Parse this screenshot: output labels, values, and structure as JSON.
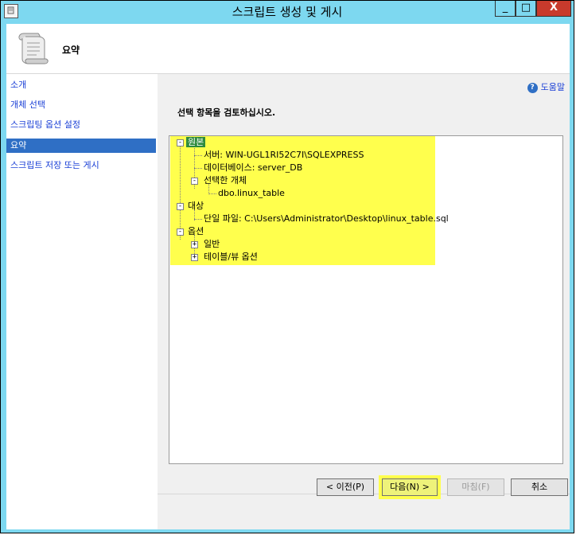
{
  "window": {
    "title": "스크립트 생성 및 게시",
    "controls": {
      "minimize": "_",
      "maximize": "□",
      "close": "X"
    }
  },
  "header": {
    "title": "요약",
    "icon": "scroll-icon"
  },
  "sidebar": {
    "items": [
      {
        "label": "소개",
        "active": false
      },
      {
        "label": "개체 선택",
        "active": false
      },
      {
        "label": "스크립팅 옵션 설정",
        "active": false
      },
      {
        "label": "요약",
        "active": true
      },
      {
        "label": "스크립트 저장 또는 게시",
        "active": false
      }
    ]
  },
  "main": {
    "help_label": "도움말",
    "instruction": "선택 항목을 검토하십시오.",
    "tree": {
      "source": {
        "label": "원본",
        "server": "서버: WIN-UGL1RI52C7I\\SQLEXPRESS",
        "database": "데이터베이스: server_DB",
        "selected_objects": "선택한 개체",
        "object": "dbo.linux_table"
      },
      "target": {
        "label": "대상",
        "file": "단일 파일: C:\\Users\\Administrator\\Desktop\\linux_table.sql"
      },
      "options": {
        "label": "옵션",
        "general": "일반",
        "table_view": "테이블/뷰 옵션"
      }
    }
  },
  "footer": {
    "prev_label": "< 이전(P)",
    "next_label": "다음(N) >",
    "finish_label": "마침(F)",
    "cancel_label": "취소"
  },
  "colors": {
    "accent": "#2f6fc5",
    "highlight": "#ffff4d",
    "selection": "#2e8b3d",
    "title_bar": "#7dd8f0"
  }
}
